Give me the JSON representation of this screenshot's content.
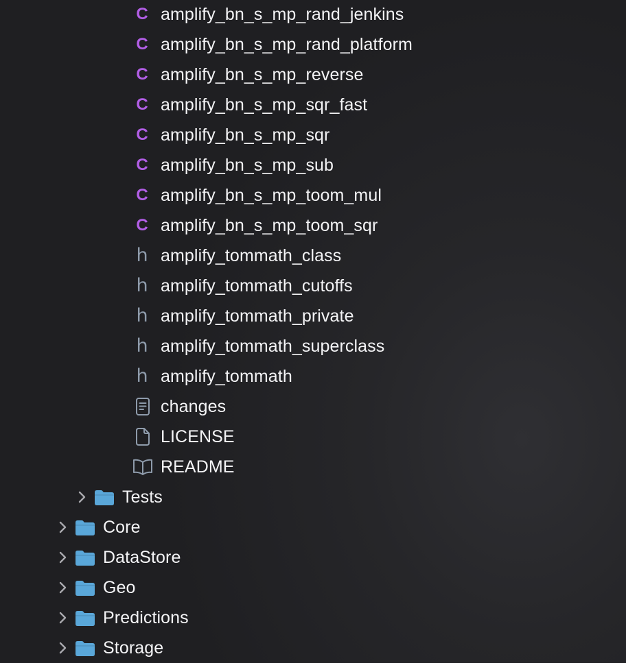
{
  "navigator": {
    "items": [
      {
        "label": "amplify_bn_s_mp_rand_jenkins",
        "icon": "c-source-file-icon",
        "level": 3
      },
      {
        "label": "amplify_bn_s_mp_rand_platform",
        "icon": "c-source-file-icon",
        "level": 3
      },
      {
        "label": "amplify_bn_s_mp_reverse",
        "icon": "c-source-file-icon",
        "level": 3
      },
      {
        "label": "amplify_bn_s_mp_sqr_fast",
        "icon": "c-source-file-icon",
        "level": 3
      },
      {
        "label": "amplify_bn_s_mp_sqr",
        "icon": "c-source-file-icon",
        "level": 3
      },
      {
        "label": "amplify_bn_s_mp_sub",
        "icon": "c-source-file-icon",
        "level": 3
      },
      {
        "label": "amplify_bn_s_mp_toom_mul",
        "icon": "c-source-file-icon",
        "level": 3
      },
      {
        "label": "amplify_bn_s_mp_toom_sqr",
        "icon": "c-source-file-icon",
        "level": 3
      },
      {
        "label": "amplify_tommath_class",
        "icon": "header-file-icon",
        "level": 3
      },
      {
        "label": "amplify_tommath_cutoffs",
        "icon": "header-file-icon",
        "level": 3
      },
      {
        "label": "amplify_tommath_private",
        "icon": "header-file-icon",
        "level": 3
      },
      {
        "label": "amplify_tommath_superclass",
        "icon": "header-file-icon",
        "level": 3
      },
      {
        "label": "amplify_tommath",
        "icon": "header-file-icon",
        "level": 3
      },
      {
        "label": "changes",
        "icon": "text-document-icon",
        "level": 3
      },
      {
        "label": "LICENSE",
        "icon": "blank-document-icon",
        "level": 3
      },
      {
        "label": "README",
        "icon": "book-icon",
        "level": 3
      },
      {
        "label": "Tests",
        "icon": "folder-icon",
        "level": 2,
        "expandable": true
      },
      {
        "label": "Core",
        "icon": "folder-icon",
        "level": 1,
        "expandable": true
      },
      {
        "label": "DataStore",
        "icon": "folder-icon",
        "level": 1,
        "expandable": true
      },
      {
        "label": "Geo",
        "icon": "folder-icon",
        "level": 1,
        "expandable": true
      },
      {
        "label": "Predictions",
        "icon": "folder-icon",
        "level": 1,
        "expandable": true
      },
      {
        "label": "Storage",
        "icon": "folder-icon",
        "level": 1,
        "expandable": true
      }
    ],
    "glyphs": {
      "c_source": "C",
      "header": "h"
    },
    "colors": {
      "c_icon": "#b25ee6",
      "header_icon": "#8e9bab",
      "folder": "#5aa7d9",
      "text": "#f4f4f6",
      "chevron": "#a9a9ae"
    }
  }
}
